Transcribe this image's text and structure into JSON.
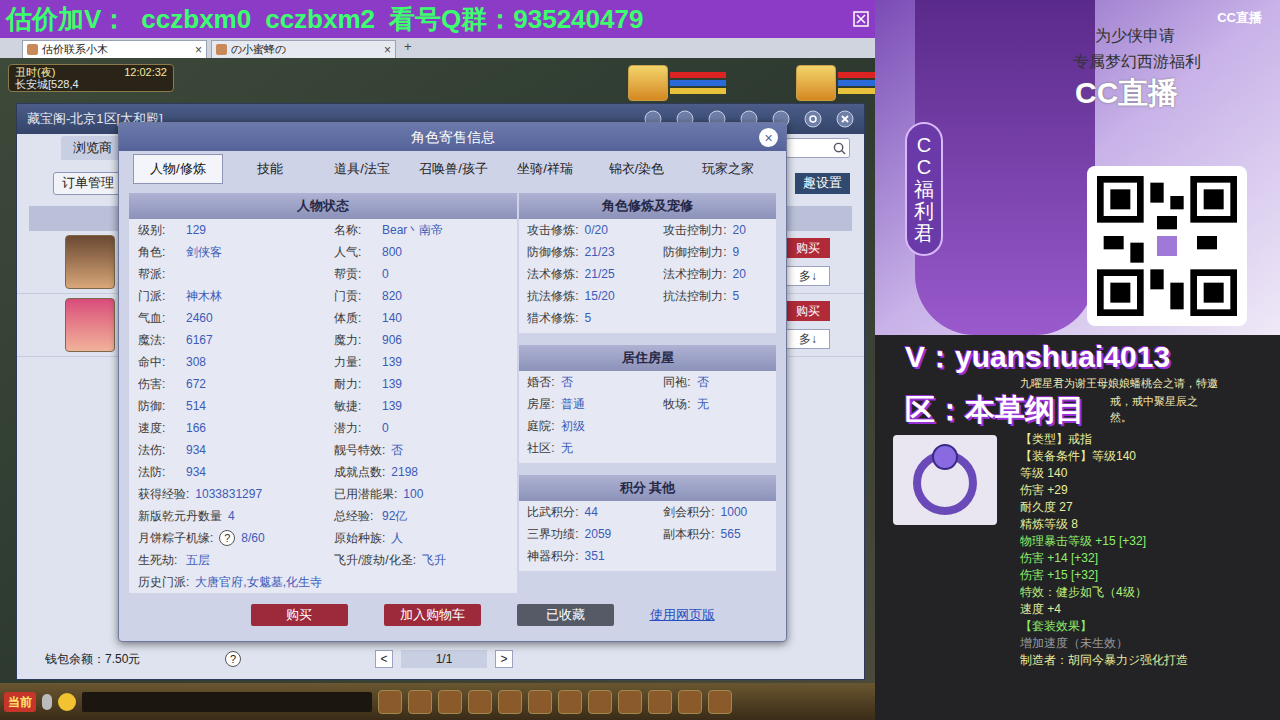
{
  "banner": {
    "label_v": "估价加V：",
    "ids": [
      "cczbxm0",
      "cczbxm2"
    ],
    "label_q": "看号Q群：935240479"
  },
  "browser_tabs": [
    {
      "label": "估价联系小木",
      "close": "×",
      "selected": true
    },
    {
      "label": "の小蜜蜂の",
      "close": "×",
      "selected": false
    }
  ],
  "browser_add": "+",
  "hud": {
    "period": "丑时(夜)",
    "time": "12:02:32",
    "location": "长安城[528,4"
  },
  "store_window": {
    "title": "藏宝阁-北京1区[太和殿]",
    "nav_tab": "浏览商",
    "order_button": "订单管理",
    "settings_link": "趣设置",
    "rows": [
      {
        "buy": "购买",
        "more": "多↓"
      },
      {
        "buy": "购买",
        "more": "多↓"
      }
    ],
    "wallet": "钱包余额：7.50元",
    "help": "?",
    "pager": {
      "prev": "<",
      "page": "1/1",
      "next": ">"
    }
  },
  "modal": {
    "title": "角色寄售信息",
    "close": "×",
    "tabs": [
      {
        "label": "人物/修炼",
        "selected": true
      },
      {
        "label": "技能",
        "selected": false
      },
      {
        "label": "道具/法宝",
        "selected": false
      },
      {
        "label": "召唤兽/孩子",
        "selected": false
      },
      {
        "label": "坐骑/祥瑞",
        "selected": false
      },
      {
        "label": "锦衣/染色",
        "selected": false
      },
      {
        "label": "玩家之家",
        "selected": false
      }
    ],
    "status": {
      "title": "人物状态",
      "rows": [
        [
          {
            "label": "级别:",
            "value": "129"
          },
          {
            "label": "名称:",
            "value": "Bear丶南帝"
          }
        ],
        [
          {
            "label": "角色:",
            "value": "剑侠客"
          },
          {
            "label": "人气:",
            "value": "800"
          }
        ],
        [
          {
            "label": "帮派:"
          },
          {
            "label": "帮贡:",
            "value": "0"
          }
        ],
        [
          {
            "label": "门派:",
            "value": "神木林"
          },
          {
            "label": "门贡:",
            "value": "820"
          }
        ],
        [
          {
            "label": "气血:",
            "value": "2460"
          },
          {
            "label": "体质:",
            "value": "140"
          }
        ],
        [
          {
            "label": "魔法:",
            "value": "6167"
          },
          {
            "label": "魔力:",
            "value": "906"
          }
        ],
        [
          {
            "label": "命中:",
            "value": "308"
          },
          {
            "label": "力量:",
            "value": "139"
          }
        ],
        [
          {
            "label": "伤害:",
            "value": "672"
          },
          {
            "label": "耐力:",
            "value": "139"
          }
        ],
        [
          {
            "label": "防御:",
            "value": "514"
          },
          {
            "label": "敏捷:",
            "value": "139"
          }
        ],
        [
          {
            "label": "速度:",
            "value": "166"
          },
          {
            "label": "潜力:",
            "value": "0"
          }
        ],
        [
          {
            "label": "法伤:",
            "value": "934"
          },
          {
            "label": "靓号特效:",
            "value": "否"
          }
        ],
        [
          {
            "label": "法防:",
            "value": "934"
          },
          {
            "label": "成就点数:",
            "value": "2198"
          }
        ],
        [
          {
            "label": "获得经验:",
            "value": "1033831297"
          },
          {
            "label": "已用潜能果:",
            "value": "100"
          }
        ],
        [
          {
            "label": "新版乾元丹数量",
            "value": "4"
          },
          {
            "label": "总经验:",
            "value": "92亿"
          }
        ],
        [
          {
            "label": "月饼粽子机缘:",
            "help": "?",
            "value": "8/60"
          },
          {
            "label": "原始种族:",
            "value": "人"
          }
        ],
        [
          {
            "label": "生死劫:",
            "value": "五层"
          },
          {
            "label": "飞升/渡劫/化圣:",
            "value": "飞升"
          }
        ]
      ],
      "history": {
        "label": "历史门派:",
        "value": "大唐官府,女魃墓,化生寺"
      }
    },
    "sections": [
      {
        "title": "角色修炼及宠修",
        "rows": [
          [
            {
              "label": "攻击修炼:",
              "value": "0/20"
            },
            {
              "label": "攻击控制力:",
              "value": "20"
            }
          ],
          [
            {
              "label": "防御修炼:",
              "value": "21/23"
            },
            {
              "label": "防御控制力:",
              "value": "9"
            }
          ],
          [
            {
              "label": "法术修炼:",
              "value": "21/25"
            },
            {
              "label": "法术控制力:",
              "value": "20"
            }
          ],
          [
            {
              "label": "抗法修炼:",
              "value": "15/20"
            },
            {
              "label": "抗法控制力:",
              "value": "5"
            }
          ],
          [
            {
              "label": "猎术修炼:",
              "value": "5"
            }
          ]
        ]
      },
      {
        "title": "居住房屋",
        "rows": [
          [
            {
              "label": "婚否:",
              "value": "否"
            },
            {
              "label": "同袍:",
              "value": "否"
            }
          ],
          [
            {
              "label": "房屋:",
              "value": "普通"
            },
            {
              "label": "牧场:",
              "value": "无"
            }
          ],
          [
            {
              "label": "庭院:",
              "value": "初级"
            }
          ],
          [
            {
              "label": "社区:",
              "value": "无"
            }
          ]
        ]
      },
      {
        "title": "积分 其他",
        "rows": [
          [
            {
              "label": "比武积分:",
              "value": "44"
            },
            {
              "label": "剑会积分:",
              "value": "1000"
            }
          ],
          [
            {
              "label": "三界功绩:",
              "value": "2059"
            },
            {
              "label": "副本积分:",
              "value": "565"
            }
          ],
          [
            {
              "label": "神器积分:",
              "value": "351"
            }
          ]
        ]
      }
    ],
    "buttons": [
      {
        "label": "购买",
        "kind": "primary"
      },
      {
        "label": "加入购物车",
        "kind": "primary"
      },
      {
        "label": "已收藏",
        "kind": "muted"
      },
      {
        "label": "使用网页版",
        "kind": "link"
      }
    ]
  },
  "bottom_bar": {
    "channel": "当前"
  },
  "ad": {
    "watermark": "CC直播",
    "line1": "为少侠申请",
    "line2": "专属梦幻西游福利",
    "logo": "CC直播",
    "badge": "CC福利君"
  },
  "promo": {
    "wechat": "V：yuanshuai4013",
    "server": "区：本草纲目"
  },
  "item_tooltip": {
    "description": [
      "九曜星君为谢王母娘娘蟠桃会之请，特邀",
      "戒，戒中聚星辰之",
      "然。"
    ],
    "lines": [
      {
        "text": "【类型】戒指",
        "color": "#e6ee9c"
      },
      {
        "text": "【装备条件】等级140",
        "color": "#e6ee9c"
      },
      {
        "text": "等级 140",
        "color": "#e6ee9c"
      },
      {
        "text": "伤害 +29",
        "color": "#e6ee9c"
      },
      {
        "text": "耐久度 27",
        "color": "#e6ee9c"
      },
      {
        "text": "精炼等级 8",
        "color": "#e6ee9c"
      },
      {
        "text": "物理暴击等级 +15 [+32]",
        "color": "#8cf06a"
      },
      {
        "text": "伤害 +14 [+32]",
        "color": "#8cf06a"
      },
      {
        "text": "伤害 +15 [+32]",
        "color": "#8cf06a"
      },
      {
        "text": "特效：健步如飞（4级）",
        "color": "#b8f07a"
      },
      {
        "text": "速度 +4",
        "color": "#e6ee9c"
      },
      {
        "text": "【套装效果】",
        "color": "#8cf06a"
      },
      {
        "text": "增加速度（未生效）",
        "color": "#9a9a9a"
      },
      {
        "text": "制造者：胡同今暴力ジ强化打造",
        "color": "#e6ee9c"
      }
    ]
  }
}
